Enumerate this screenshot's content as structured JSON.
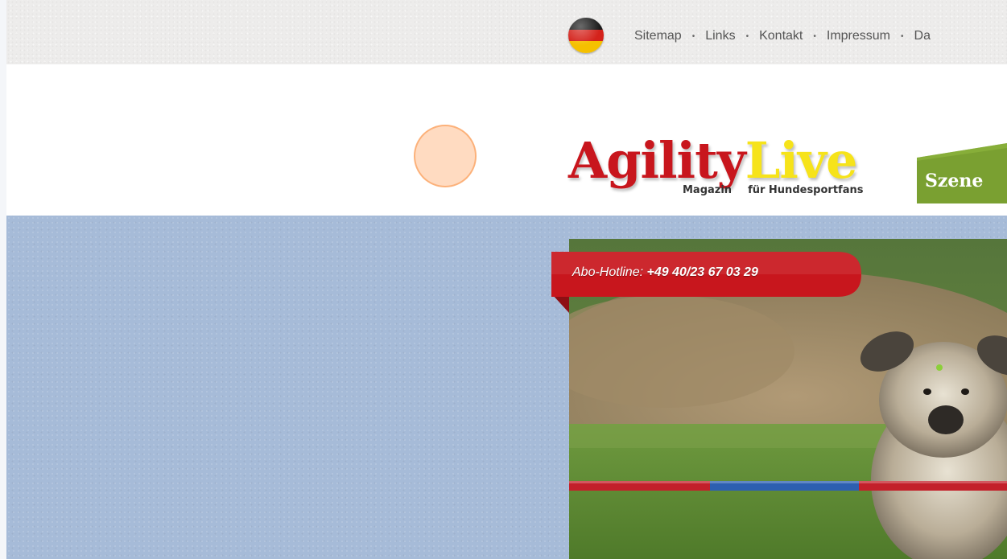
{
  "topbar": {
    "language_flag": "germany-flag-icon",
    "nav": [
      {
        "label": "Sitemap"
      },
      {
        "label": "Links"
      },
      {
        "label": "Kontakt"
      },
      {
        "label": "Impressum"
      },
      {
        "label": "Da"
      }
    ],
    "separator": "•"
  },
  "header": {
    "logo_word_1": "Agility",
    "logo_word_2": "Live",
    "logo_tag_1": "Magazin",
    "logo_tag_2": "für Hundesportfans",
    "tab_label": "Szene"
  },
  "hero": {
    "hotline_label": "Abo-Hotline:",
    "hotline_number": "+49 40/23 67 03 29"
  },
  "colors": {
    "topbar": "#edeceb",
    "main_bg": "#a6bbd8",
    "logo_red": "#c8161d",
    "logo_yellow": "#f6e31a",
    "tab_green": "#7aa031",
    "hotline_red": "#c8161d"
  }
}
